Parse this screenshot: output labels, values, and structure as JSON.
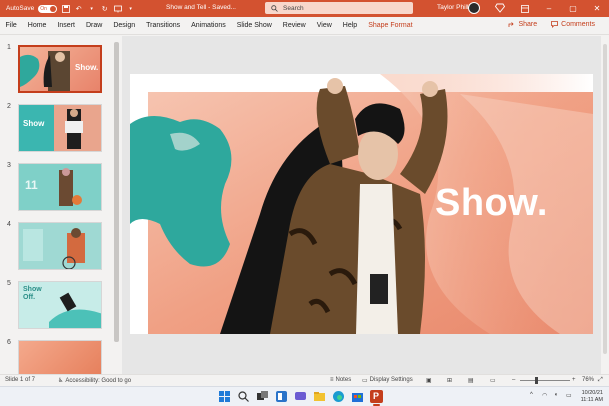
{
  "titlebar": {
    "autosave_label": "AutoSave",
    "autosave_state": "On",
    "filename": "Show and Tell - Saved...",
    "search_placeholder": "Search",
    "user_name": "Taylor Phillips",
    "accent_color": "#d35230"
  },
  "ribbon": {
    "tabs": [
      "File",
      "Home",
      "Insert",
      "Draw",
      "Design",
      "Transitions",
      "Animations",
      "Slide Show",
      "Review",
      "View",
      "Help",
      "Shape Format"
    ],
    "share_label": "Share",
    "comments_label": "Comments"
  },
  "thumbnails": [
    {
      "num": "1",
      "text": "Show."
    },
    {
      "num": "2",
      "text": "Show"
    },
    {
      "num": "3",
      "text": "11"
    },
    {
      "num": "4",
      "text": ""
    },
    {
      "num": "5",
      "text": "Show Off."
    },
    {
      "num": "6",
      "text": ""
    }
  ],
  "slide": {
    "title": "Show."
  },
  "status": {
    "slide_info": "Slide 1 of 7",
    "accessibility": "Accessibility: Good to go",
    "notes_label": "Notes",
    "display_settings_label": "Display Settings",
    "zoom": "76%"
  },
  "taskbar": {
    "date": "10/20/21",
    "time": "11:11 AM"
  }
}
